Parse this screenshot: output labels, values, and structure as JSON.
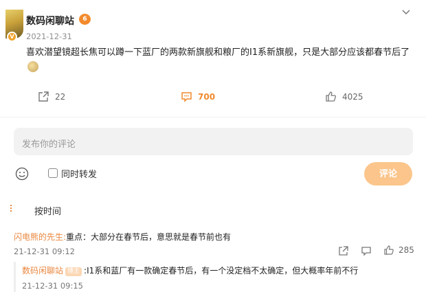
{
  "post": {
    "author": "数码闲聊站",
    "level_badge": "6",
    "date": "2021-12-31",
    "text": "喜欢潜望镜超长焦可以蹲一下蓝厂的两款新旗舰和粮厂的I1系新旗舰，只是大部分应该都春节后了"
  },
  "actions": {
    "repost_count": "22",
    "comment_count": "700",
    "like_count": "4025"
  },
  "composer": {
    "placeholder": "发布你的评论",
    "repost_label": "同时转发",
    "submit_label": "评论"
  },
  "sort": {
    "label": "按时间"
  },
  "comments": [
    {
      "author": "闪电熊的先生:",
      "text": "重点：大部分在春节后，意思就是春节前也有",
      "time": "21-12-31 09:12",
      "like_count": "285"
    }
  ],
  "reply": {
    "author": "数码闲聊站",
    "role_badge": "博主",
    "text": ":I1系和蓝厂有一款确定春节后，有一个没定档不太确定，但大概率年前不行",
    "time": "21-12-31 09:15"
  },
  "colors": {
    "accent": "#f08a2e",
    "submit_bg": "#fbc58b"
  }
}
